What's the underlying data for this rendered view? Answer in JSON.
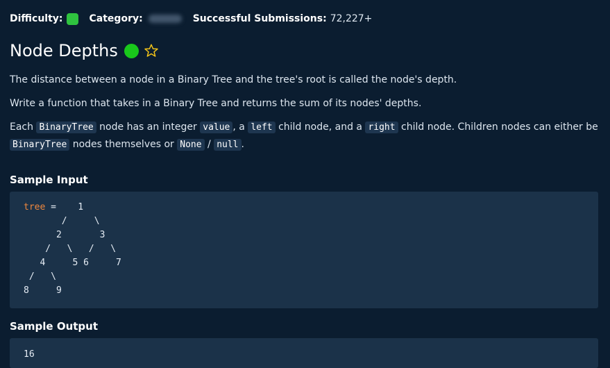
{
  "meta": {
    "difficulty_label": "Difficulty:",
    "difficulty_color": "#2fc33f",
    "category_label": "Category:",
    "submissions_label": "Successful Submissions:",
    "submissions_value": "72,227+"
  },
  "problem": {
    "title": "Node Depths",
    "status_color": "#19c81b",
    "star_icon": "star-outline-icon",
    "star_color": "#f5c518"
  },
  "description": {
    "p1": "The distance between a node in a Binary Tree and the tree's root is called the node's depth.",
    "p2": "Write a function that takes in a Binary Tree and returns the sum of its nodes' depths.",
    "p3": {
      "t1": "Each ",
      "c1": "BinaryTree",
      "t2": " node has an integer ",
      "c2": "value",
      "t3": ", a ",
      "c3": "left",
      "t4": " child node, and a ",
      "c4": "right",
      "t5": " child node. Children nodes can either be ",
      "c5": "BinaryTree",
      "t6": " nodes themselves or ",
      "c6": "None",
      "t7": " / ",
      "c7": "null",
      "t8": "."
    }
  },
  "sample_input": {
    "heading": "Sample Input",
    "var_name": "tree",
    "assign": " =    1",
    "lines": [
      "       /     \\",
      "      2       3",
      "    /   \\   /   \\",
      "   4     5 6     7",
      " /   \\",
      "8     9"
    ]
  },
  "sample_output": {
    "heading": "Sample Output",
    "value": "16"
  }
}
